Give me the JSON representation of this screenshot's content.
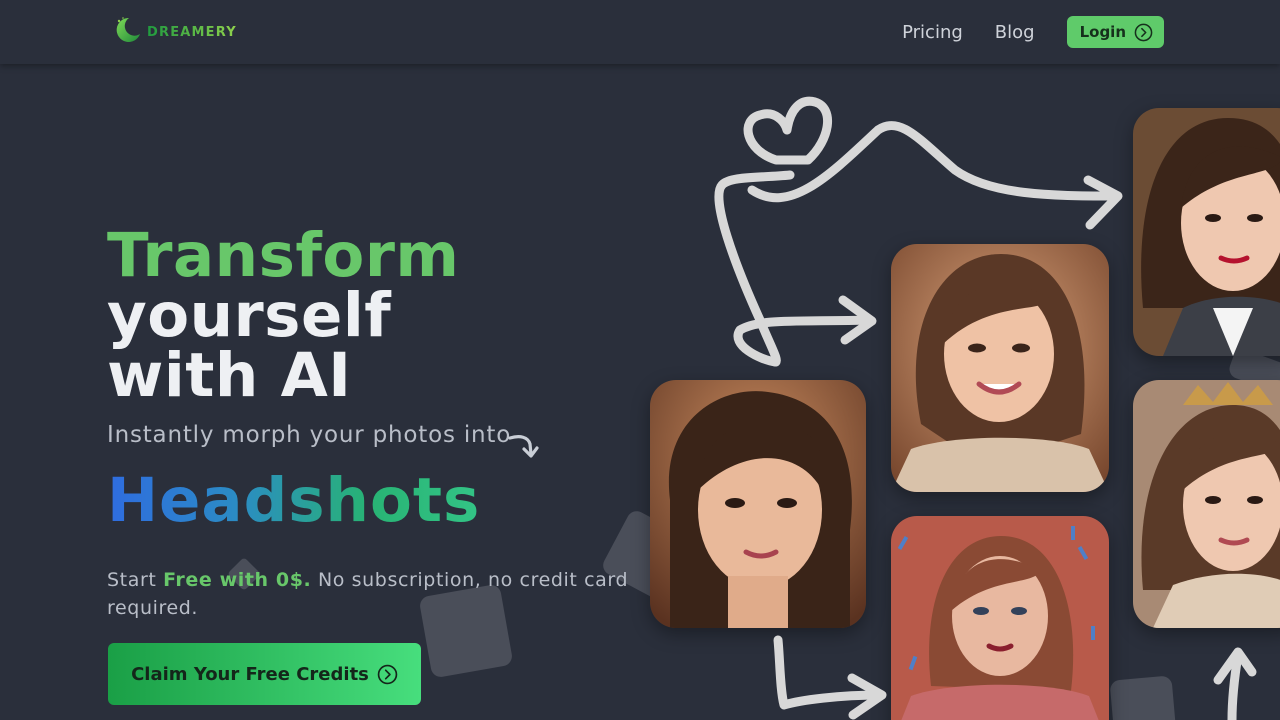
{
  "header": {
    "logo_text": "DREAMERY",
    "nav": {
      "pricing": "Pricing",
      "blog": "Blog",
      "login": "Login"
    }
  },
  "hero": {
    "title_line1": "Transform",
    "title_line2": "yourself",
    "title_line3": "with AI",
    "subtitle": "Instantly morph your photos into",
    "highlight": "Headshots",
    "promo_start": "Start ",
    "promo_bold": "Free with 0$.",
    "promo_rest": " No subscription, no credit card required.",
    "cta_label": "Claim Your Free Credits"
  },
  "gallery": {
    "photos": [
      {
        "alt": "portrait-woman-brown-background"
      },
      {
        "alt": "portrait-woman-smiling-sweater"
      },
      {
        "alt": "portrait-woman-red-confetti"
      },
      {
        "alt": "portrait-woman-business-suit"
      },
      {
        "alt": "portrait-woman-crown"
      }
    ]
  },
  "colors": {
    "background": "#2a2f3b",
    "accent_green": "#68c76a",
    "login_bg": "#5fcb6a",
    "headshots_gradient_start": "#2f6ce0",
    "headshots_gradient_end": "#33c486"
  },
  "icons": {
    "logo": "moon-icon",
    "login": "chevron-right-circle-icon",
    "cta": "chevron-right-circle-icon",
    "subtitle": "curved-arrow-icon"
  }
}
